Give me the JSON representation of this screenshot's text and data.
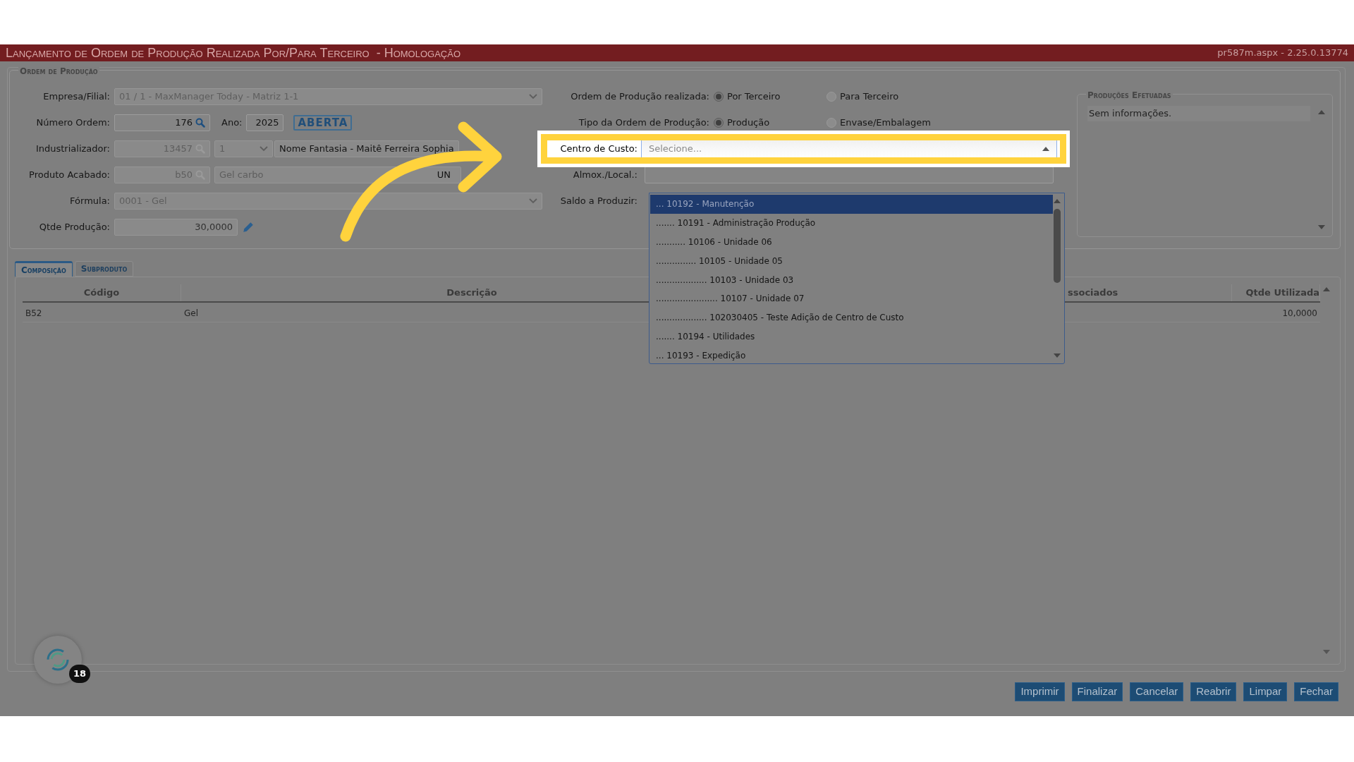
{
  "window": {
    "title": "Lançamento de Ordem de Produção Realizada Por/Para Terceiro  - Homologação",
    "page_info": "pr587m.aspx - 2.25.0.13774"
  },
  "ordem_producao": {
    "legend": "Ordem de Produção",
    "empresa_filial": {
      "label": "Empresa/Filial:",
      "value": "01 / 1 - MaxManager Today - Matriz 1-1"
    },
    "numero_ordem": {
      "label": "Número Ordem:",
      "value": "176",
      "ano_label": "Ano:",
      "ano": "2025",
      "status": "ABERTA"
    },
    "industrializador": {
      "label": "Industrializador:",
      "code": "13457",
      "option": "1",
      "name": "Nome Fantasia - Maitê Ferreira Sophia"
    },
    "produto_acabado": {
      "label": "Produto Acabado:",
      "code": "b50",
      "description": "Gel carbo",
      "unit": "UN"
    },
    "formula": {
      "label": "Fórmula:",
      "value": "0001 - Gel"
    },
    "qtde_producao": {
      "label": "Qtde Produção:",
      "value": "30,0000"
    },
    "realizada": {
      "label": "Ordem de Produção realizada:",
      "options": [
        {
          "label": "Por Terceiro",
          "selected": true
        },
        {
          "label": "Para Terceiro",
          "selected": false
        }
      ]
    },
    "tipo": {
      "label": "Tipo da Ordem de Produção:",
      "options": [
        {
          "label": "Produção",
          "selected": true
        },
        {
          "label": "Envase/Embalagem",
          "selected": false
        }
      ]
    },
    "centro_de_custo": {
      "label": "Centro de Custo:",
      "placeholder": "Selecione...",
      "expanded": true,
      "highlighted": true,
      "options": [
        {
          "label": "... 10192 - Manutenção",
          "selected": true
        },
        {
          "label": "....... 10191 - Administração Produção",
          "selected": false
        },
        {
          "label": "........... 10106 - Unidade 06",
          "selected": false
        },
        {
          "label": "............... 10105 - Unidade 05",
          "selected": false
        },
        {
          "label": "................... 10103 - Unidade 03",
          "selected": false
        },
        {
          "label": "....................... 10107 - Unidade 07",
          "selected": false
        },
        {
          "label": "................... 102030405 - Teste Adição de Centro de Custo",
          "selected": false
        },
        {
          "label": "....... 10194 - Utilidades",
          "selected": false
        },
        {
          "label": "... 10193 - Expedição",
          "selected": false
        }
      ]
    },
    "almox_local": {
      "label": "Almox./Local.:"
    },
    "saldo_a_produzir": {
      "label": "Saldo a Produzir:"
    }
  },
  "producoes_efetuadas": {
    "legend": "Produções Efetuadas",
    "empty_text": "Sem informações."
  },
  "tabs": [
    {
      "label": "Composição",
      "selected": true
    },
    {
      "label": "Subproduto",
      "selected": false
    }
  ],
  "table": {
    "columns": [
      "Código",
      "Descrição",
      "ssociados",
      "Qtde Utilizada"
    ],
    "rows": [
      [
        "B52",
        "Gel",
        "",
        "10,0000"
      ]
    ]
  },
  "buttons": [
    "Imprimir",
    "Finalizar",
    "Cancelar",
    "Reabrir",
    "Limpar",
    "Fechar"
  ],
  "chat_widget": {
    "badge": "18"
  }
}
